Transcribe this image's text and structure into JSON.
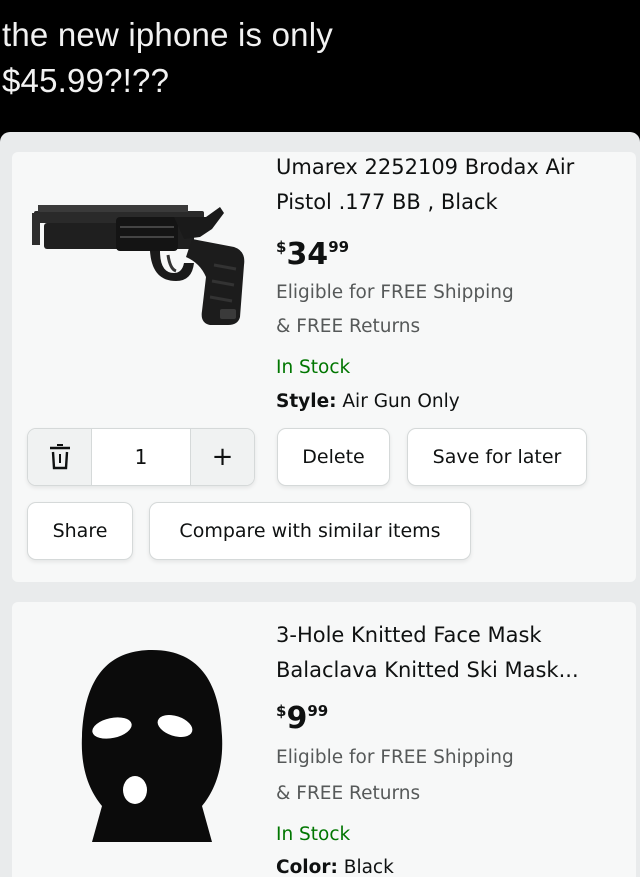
{
  "caption": {
    "line1": "the new iphone is only",
    "line2": "$45.99?!??"
  },
  "items": [
    {
      "title_line1": "Umarex 2252109 Brodax Air",
      "title_line2": "Pistol .177 BB , Black",
      "price_symbol": "$",
      "price_whole": "34",
      "price_fraction": "99",
      "shipping": "Eligible for FREE Shipping",
      "returns": "& FREE Returns",
      "stock": "In Stock",
      "attr_label": "Style:",
      "attr_value": "Air Gun Only",
      "image_icon": "air-pistol-image"
    },
    {
      "title_line1": "3-Hole Knitted Face Mask",
      "title_line2": "Balaclava Knitted Ski Mask...",
      "price_symbol": "$",
      "price_whole": "9",
      "price_fraction": "99",
      "shipping": "Eligible for FREE Shipping",
      "returns": "& FREE Returns",
      "stock": "In Stock",
      "attr_label": "Color:",
      "attr_value": "Black",
      "image_icon": "ski-mask-image"
    }
  ],
  "cart_controls": {
    "quantity": "1",
    "plus": "+",
    "delete": "Delete",
    "save_for_later": "Save for later",
    "share": "Share",
    "compare": "Compare with similar items"
  },
  "colors": {
    "background": "#000000",
    "screen": "#e9ebec",
    "card": "#f7f8f8",
    "in_stock_green": "#007600",
    "text_dark": "#0f1111",
    "text_gray": "#565959"
  }
}
